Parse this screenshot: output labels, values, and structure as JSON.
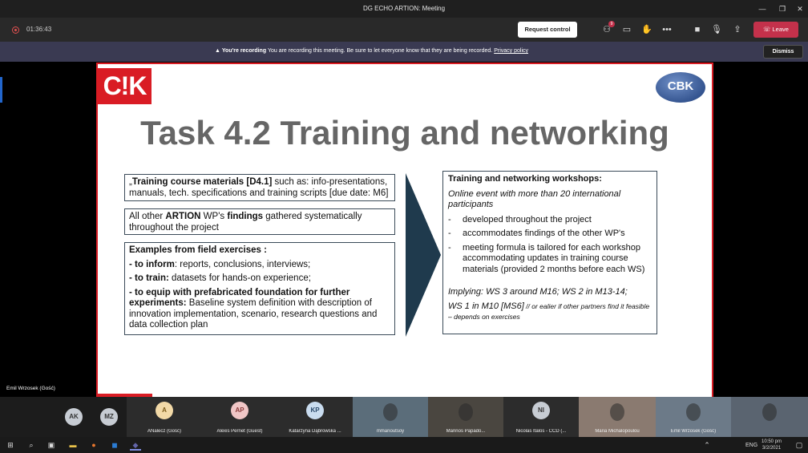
{
  "window": {
    "title": "DG ECHO ARTION: Meeting"
  },
  "toolbar": {
    "timer": "01:36:43",
    "request_control": "Request control",
    "leave": "Leave",
    "participants_badge": "9"
  },
  "banner": {
    "label": "You're recording",
    "message": "You are recording this meeting. Be sure to let everyone know that they are being recorded.",
    "link": "Privacy policy",
    "dismiss": "Dismiss"
  },
  "slide": {
    "logo_left": "C!K",
    "logo_right": "CBK",
    "title": "Task 4.2 Training and networking",
    "box1": {
      "prefix": "„",
      "bold": "Training course materials [D4.1]",
      "rest": " such as: info-presentations, manuals, tech. specifications and training scripts [due date: M6]"
    },
    "box2": {
      "t1": "All other ",
      "b1": "ARTION",
      "t2": " WP's ",
      "b2": "findings",
      "t3": " gathered systematically throughout the project"
    },
    "box3": {
      "heading": "Examples from field exercises :",
      "l1_bold": "- to inform",
      "l1_rest": ": reports, conclusions, interviews;",
      "l2_bold": "- to train:",
      "l2_rest": " datasets for hands-on experience;",
      "l3_bold": "- to equip with prefabricated foundation for further experiments:",
      "l3_rest": " Baseline system definition with description of innovation implementation, scenario, research questions and data collection plan"
    },
    "right": {
      "heading": "Training and networking workshops:",
      "intro": "Online event with more than 20 international participants",
      "items": [
        "developed throughout the project",
        "accommodates findings of the other WP's",
        "meeting formula is tailored for each workshop accommodating updates in training course materials (provided 2 months before each WS)"
      ],
      "implying": "Implying:  WS 3 around M16; WS 2 in M13-14;",
      "ws1": "WS 1 in M10 [MS6]",
      "ws1_note": " // or ealier if other partners find it feasible – depends on exercises"
    }
  },
  "speaker_label": "Emil Wrzosek (Gość)",
  "participants": [
    {
      "initials": "AK",
      "name": "",
      "color": "#c7ccd3",
      "text": "#333"
    },
    {
      "initials": "MZ",
      "name": "",
      "color": "#c7ccd3",
      "text": "#333"
    },
    {
      "initials": "A",
      "name": "ANalecz (Gość)",
      "color": "#f2d9a7",
      "text": "#7a5a1a"
    },
    {
      "initials": "AP",
      "name": "Alexis Pernet (Guest)",
      "color": "#f0c6c6",
      "text": "#8a3a3a"
    },
    {
      "initials": "KP",
      "name": "Katarzyna Dąbrowska ...",
      "color": "#c9dcef",
      "text": "#2a4a6a"
    },
    {
      "initials": "",
      "name": "mmanoutsoy",
      "color": "#5b6d7a",
      "text": "#fff"
    },
    {
      "initials": "",
      "name": "Marinos Papado...",
      "color": "#4a4640",
      "text": "#fff"
    },
    {
      "initials": "NI",
      "name": "Nicolas Italos - CCD (...",
      "color": "#c7ccd3",
      "text": "#333"
    },
    {
      "initials": "",
      "name": "Maria Michalopoulou",
      "color": "#8a7a70",
      "text": "#fff"
    },
    {
      "initials": "",
      "name": "Emil Wrzosek (Gość)",
      "color": "#6c7a88",
      "text": "#fff"
    },
    {
      "initials": "",
      "name": "",
      "color": "#5a6470",
      "text": "#fff"
    }
  ],
  "taskbar": {
    "lang": "ENG",
    "time": "10:50 pm",
    "date": "3/2/2021"
  }
}
